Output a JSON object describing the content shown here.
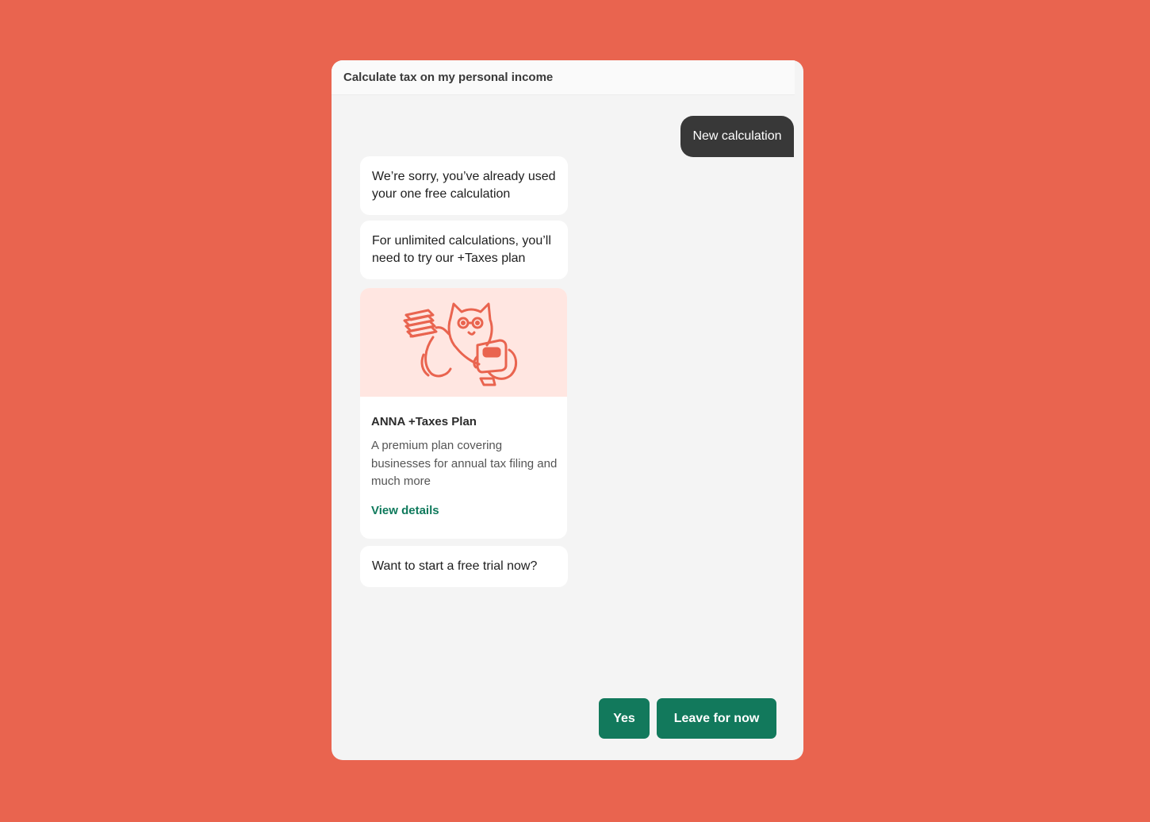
{
  "header": {
    "title": "Calculate tax on my personal income"
  },
  "conversation": {
    "user_message": "New calculation",
    "bot_messages": [
      "We’re sorry, you’ve already used your one free calculation",
      "For unlimited calculations, you’ll need to try our +Taxes plan",
      "Want to start a free trial now?"
    ]
  },
  "plan_card": {
    "illustration_icon": "cat-with-documents-illustration",
    "title": "ANNA +Taxes Plan",
    "description": "A premium plan covering businesses for annual tax filing and much more",
    "link_label": "View details"
  },
  "actions": {
    "yes_label": "Yes",
    "leave_label": "Leave for now"
  },
  "colors": {
    "background": "#E9644F",
    "accent_green": "#12795C",
    "user_bubble": "#383838",
    "illustration_bg": "#FFE6E1"
  }
}
